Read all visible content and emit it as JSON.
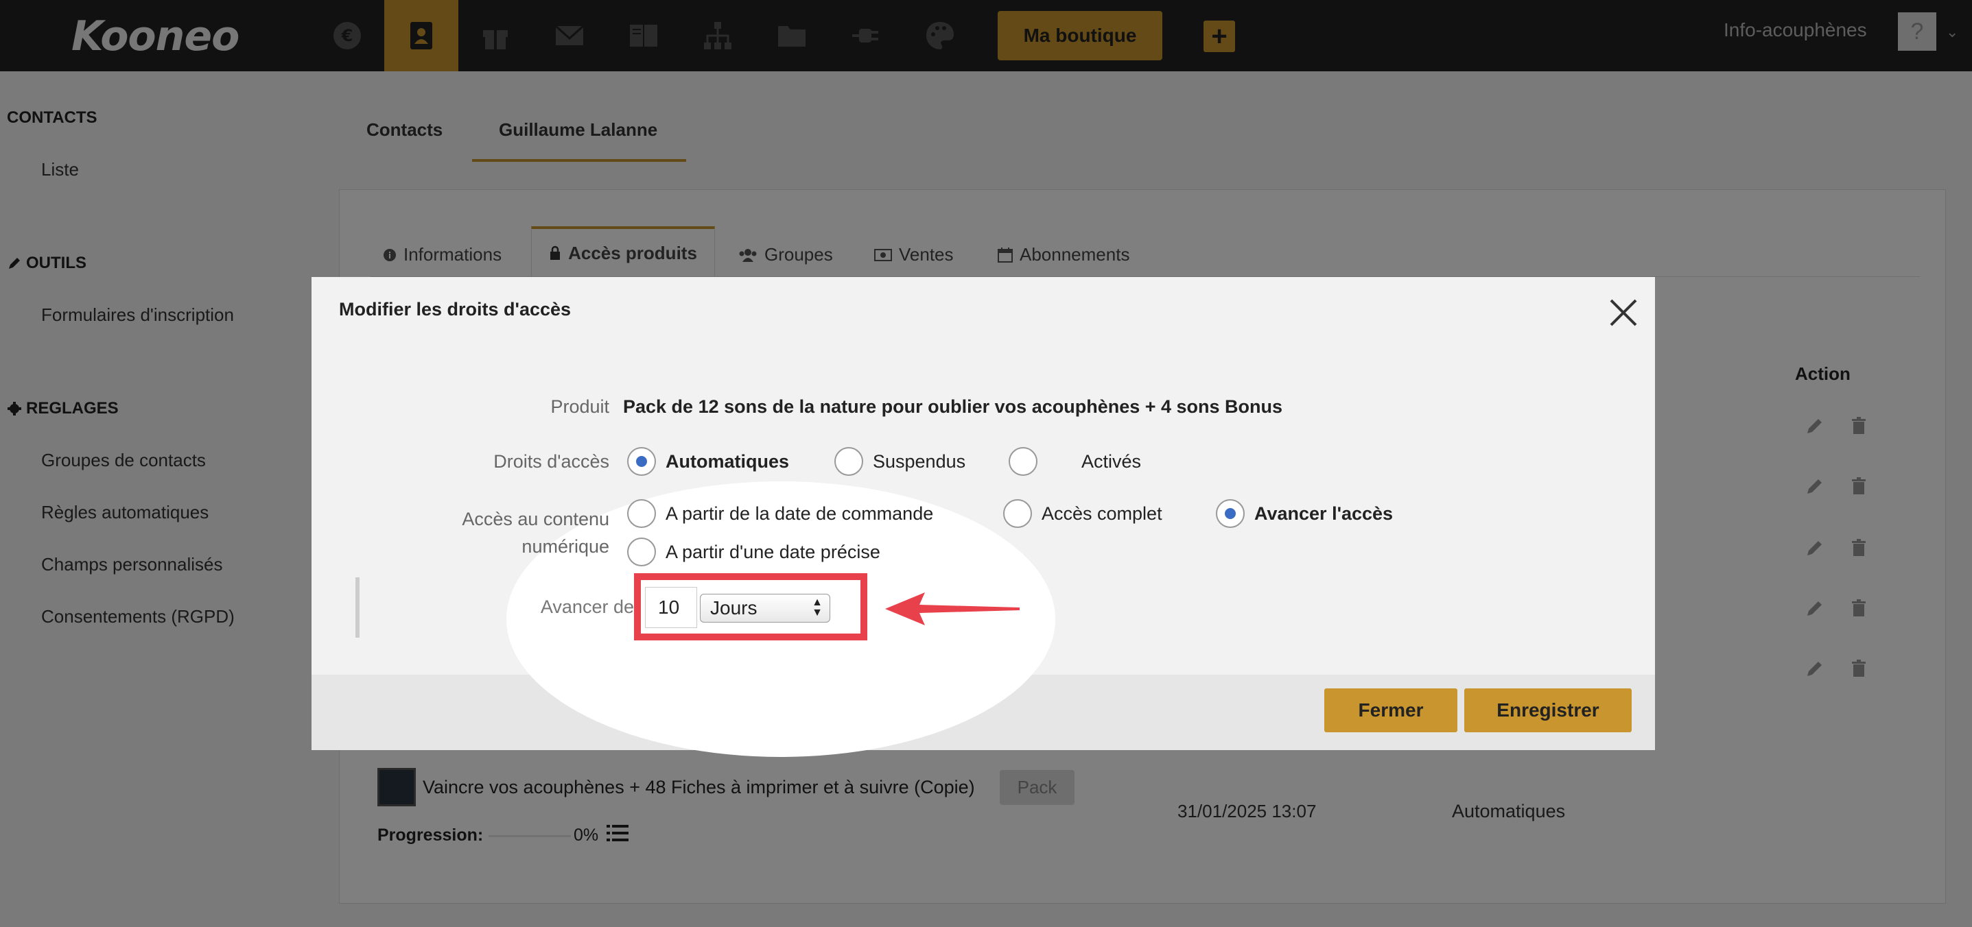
{
  "topbar": {
    "logo": "Kooneo",
    "shop_button": "Ma boutique",
    "plus": "+",
    "site_name": "Info-acouphènes",
    "nav_icons": [
      "euro-icon",
      "contacts-icon",
      "gift-icon",
      "mail-icon",
      "book-icon",
      "sitemap-icon",
      "folder-icon",
      "plug-icon",
      "palette-icon"
    ]
  },
  "sidebar": {
    "contacts_head": "CONTACTS",
    "liste": "Liste",
    "outils_head": "OUTILS",
    "formulaires": "Formulaires d'inscription",
    "reglages_head": "REGLAGES",
    "groupes": "Groupes de contacts",
    "regles": "Règles automatiques",
    "champs": "Champs personnalisés",
    "consentements": "Consentements (RGPD)"
  },
  "main": {
    "tabs": [
      "Contacts",
      "Guillaume Lalanne"
    ],
    "subtabs": [
      "Informations",
      "Accès produits",
      "Groupes",
      "Ventes",
      "Abonnements"
    ],
    "action_header": "Action",
    "row": {
      "name": "Vaincre vos acouphènes + 48 Fiches à imprimer et à suivre (Copie)",
      "badge": "Pack",
      "progress_label": "Progression:",
      "progress_value": "0%",
      "date": "31/01/2025 13:07",
      "rights": "Automatiques"
    }
  },
  "modal": {
    "title": "Modifier les droits d'accès",
    "produit_label": "Produit",
    "produit_value": "Pack de 12 sons de la nature pour oublier vos acouphènes + 4 sons Bonus",
    "droits_label": "Droits d'accès",
    "droits_options": [
      "Automatiques",
      "Suspendus",
      "Activés"
    ],
    "droits_selected": "Automatiques",
    "acces_label_1": "Accès au contenu",
    "acces_label_2": "numérique",
    "acces_options": [
      "A partir de la date de commande",
      "Accès complet",
      "Avancer l'accès",
      "A partir d'une date précise"
    ],
    "acces_selected": "Avancer l'accès",
    "avancer_label": "Avancer de",
    "avancer_value": "10",
    "unit_selected": "Jours",
    "close_button": "Fermer",
    "save_button": "Enregistrer"
  },
  "colors": {
    "accent": "#c8952e",
    "topbar": "#222222",
    "highlight": "#e8414b",
    "radio_checked": "#3b6cc4"
  }
}
